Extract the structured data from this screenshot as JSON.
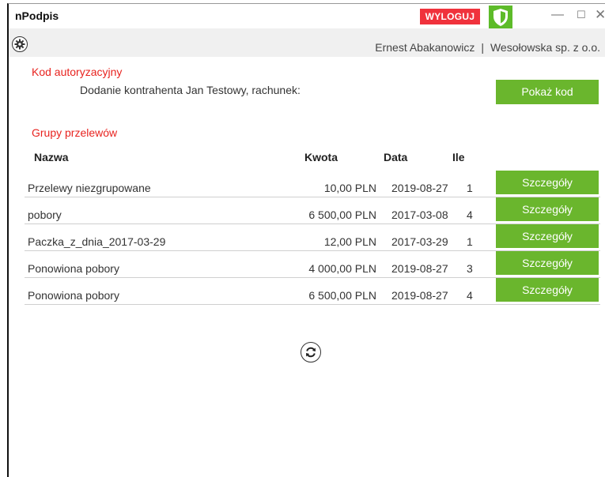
{
  "app": {
    "title": "nPodpis"
  },
  "titlebar": {
    "logout_label": "WYLOGUJ",
    "minimize": "—",
    "maximize": "☐",
    "close": "✕"
  },
  "header": {
    "user_name": "Ernest Abakanowicz",
    "separator": "|",
    "company": "Wesołowska sp. z o.o."
  },
  "auth": {
    "title": "Kod autoryzacyjny",
    "description": "Dodanie kontrahenta Jan Testowy, rachunek:",
    "show_code_label": "Pokaż kod"
  },
  "groups": {
    "title": "Grupy przelewów",
    "columns": {
      "name": "Nazwa",
      "amount": "Kwota",
      "date": "Data",
      "count": "Ile"
    },
    "details_label": "Szczegóły",
    "rows": [
      {
        "name": "Przelewy niezgrupowane",
        "amount": "10,00 PLN",
        "date": "2019-08-27",
        "count": "1"
      },
      {
        "name": "pobory",
        "amount": "6 500,00 PLN",
        "date": "2017-03-08",
        "count": "4"
      },
      {
        "name": "Paczka_z_dnia_2017-03-29",
        "amount": "12,00 PLN",
        "date": "2017-03-29",
        "count": "1"
      },
      {
        "name": "Ponowiona pobory",
        "amount": "4 000,00 PLN",
        "date": "2019-08-27",
        "count": "3"
      },
      {
        "name": "Ponowiona pobory",
        "amount": "6 500,00 PLN",
        "date": "2019-08-27",
        "count": "4"
      }
    ]
  },
  "colors": {
    "accent_green": "#6ab62d",
    "logout_red": "#f0323c",
    "section_red": "#e8231f"
  },
  "icons": {
    "settings": "gear-icon",
    "security": "shield-icon",
    "refresh": "refresh-icon"
  }
}
